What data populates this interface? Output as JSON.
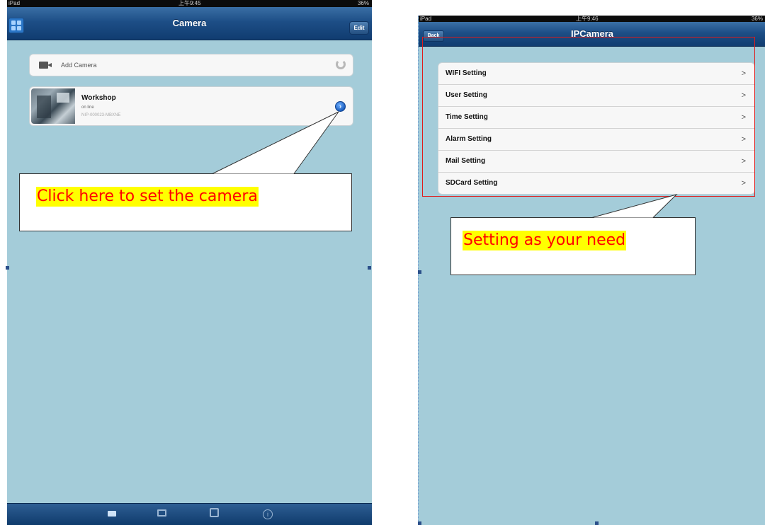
{
  "left_screen": {
    "status": {
      "left": "iPad",
      "time": "上午9:45",
      "right": "36%"
    },
    "nav": {
      "title": "Camera",
      "edit_label": "Edit",
      "grid_icon": "grid-icon"
    },
    "add_camera": {
      "label": "Add Camera",
      "camera_icon": "camera-icon",
      "refresh_icon": "refresh-icon"
    },
    "camera": {
      "name": "Workshop",
      "status": "on line",
      "id": "NIP-000023-MBXNE",
      "detail_icon": "detail-disclosure-icon"
    },
    "tabbar": {
      "icons": [
        "camera-icon",
        "picture-icon",
        "video-icon",
        "info-icon"
      ]
    }
  },
  "right_screen": {
    "status": {
      "left": "iPad",
      "time": "上午9:46",
      "right": "36%"
    },
    "nav": {
      "title": "IPCamera",
      "back_label": "Back"
    },
    "settings": [
      {
        "label": "WIFI Setting"
      },
      {
        "label": "User Setting"
      },
      {
        "label": "Time Setting"
      },
      {
        "label": "Alarm Setting"
      },
      {
        "label": "Mail Setting"
      },
      {
        "label": "SDCard Setting"
      }
    ],
    "chevron": ">"
  },
  "callouts": {
    "left": "Click here to set the camera",
    "right": "Setting as your need"
  },
  "colors": {
    "background": "#a4ccd9",
    "nav_bar": "#1d4e86",
    "callout_text": "#ff0000",
    "callout_highlight": "#ffff00",
    "highlight_border": "#e01b1b"
  }
}
